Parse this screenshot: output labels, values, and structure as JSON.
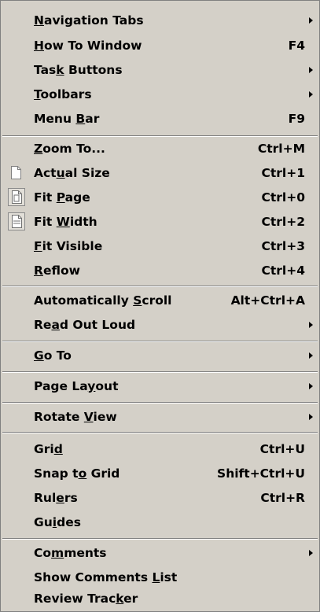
{
  "menu": {
    "navigation_tabs": {
      "before": "",
      "accel": "N",
      "after": "avigation Tabs"
    },
    "how_to_window": {
      "before": "",
      "accel": "H",
      "after": "ow To Window",
      "shortcut": "F4"
    },
    "task_buttons": {
      "before": "Tas",
      "accel": "k",
      "after": " Buttons"
    },
    "toolbars": {
      "before": "",
      "accel": "T",
      "after": "oolbars"
    },
    "menu_bar": {
      "before": "Menu ",
      "accel": "B",
      "after": "ar",
      "shortcut": "F9"
    },
    "zoom_to": {
      "before": "",
      "accel": "Z",
      "after": "oom To...",
      "shortcut": "Ctrl+M"
    },
    "actual_size": {
      "before": "Act",
      "accel": "u",
      "after": "al Size",
      "shortcut": "Ctrl+1"
    },
    "fit_page": {
      "before": "Fit ",
      "accel": "P",
      "after": "age",
      "shortcut": "Ctrl+0"
    },
    "fit_width": {
      "before": "Fit ",
      "accel": "W",
      "after": "idth",
      "shortcut": "Ctrl+2"
    },
    "fit_visible": {
      "before": "",
      "accel": "F",
      "after": "it Visible",
      "shortcut": "Ctrl+3"
    },
    "reflow": {
      "before": "",
      "accel": "R",
      "after": "eflow",
      "shortcut": "Ctrl+4"
    },
    "automatically_scroll": {
      "before": "Automatically ",
      "accel": "S",
      "after": "croll",
      "shortcut": "Alt+Ctrl+A"
    },
    "read_out_loud": {
      "before": "Re",
      "accel": "a",
      "after": "d Out Loud"
    },
    "go_to": {
      "before": "",
      "accel": "G",
      "after": "o To"
    },
    "page_layout": {
      "before": "Page La",
      "accel": "y",
      "after": "out"
    },
    "rotate_view": {
      "before": "Rotate ",
      "accel": "V",
      "after": "iew"
    },
    "grid": {
      "before": "Gri",
      "accel": "d",
      "after": "",
      "shortcut": "Ctrl+U"
    },
    "snap_to_grid": {
      "before": "Snap t",
      "accel": "o",
      "after": " Grid",
      "shortcut": "Shift+Ctrl+U"
    },
    "rulers": {
      "before": "Rul",
      "accel": "e",
      "after": "rs",
      "shortcut": "Ctrl+R"
    },
    "guides": {
      "before": "Gu",
      "accel": "i",
      "after": "des"
    },
    "comments": {
      "before": "Co",
      "accel": "m",
      "after": "ments"
    },
    "show_comments_list": {
      "before": "Show Comments ",
      "accel": "L",
      "after": "ist"
    },
    "review_tracker": {
      "before": "Review Trac",
      "accel": "k",
      "after": "er"
    }
  },
  "icons": {
    "submenu": "triangle-right",
    "page": "page-icon",
    "fit_page": "fit-page-icon",
    "fit_width": "fit-width-icon"
  }
}
